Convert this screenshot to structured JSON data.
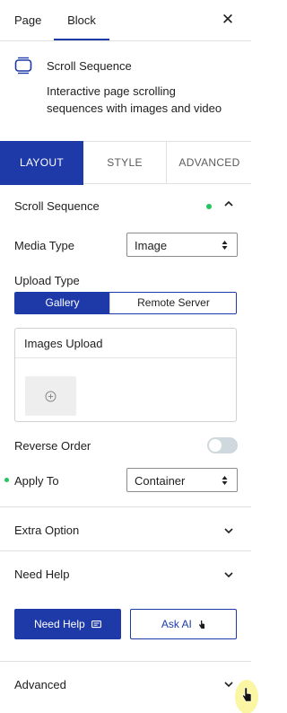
{
  "top_tabs": {
    "page": "Page",
    "block": "Block",
    "close": "✕"
  },
  "block_card": {
    "title": "Scroll Sequence",
    "description": "Interactive page scrolling sequences with images and video",
    "icon": "scroll-sequence-icon"
  },
  "sub_tabs": {
    "layout": "LAYOUT",
    "style": "STYLE",
    "advanced": "ADVANCED"
  },
  "scroll_section": {
    "title": "Scroll Sequence",
    "media_type_label": "Media Type",
    "media_type_value": "Image",
    "upload_type_label": "Upload Type",
    "upload_options": [
      "Gallery",
      "Remote Server"
    ],
    "images_upload_label": "Images Upload",
    "reverse_order_label": "Reverse Order",
    "reverse_order_on": false,
    "apply_to_label": "Apply To",
    "apply_to_value": "Container"
  },
  "panels": {
    "extra_option": "Extra Option",
    "need_help": "Need Help",
    "advanced": "Advanced"
  },
  "buttons": {
    "need_help": "Need Help",
    "ask_ai": "Ask AI"
  },
  "colors": {
    "accent": "#1e3aa8",
    "status_dot": "#22c55e",
    "toggle_off": "#cfd8dd"
  }
}
